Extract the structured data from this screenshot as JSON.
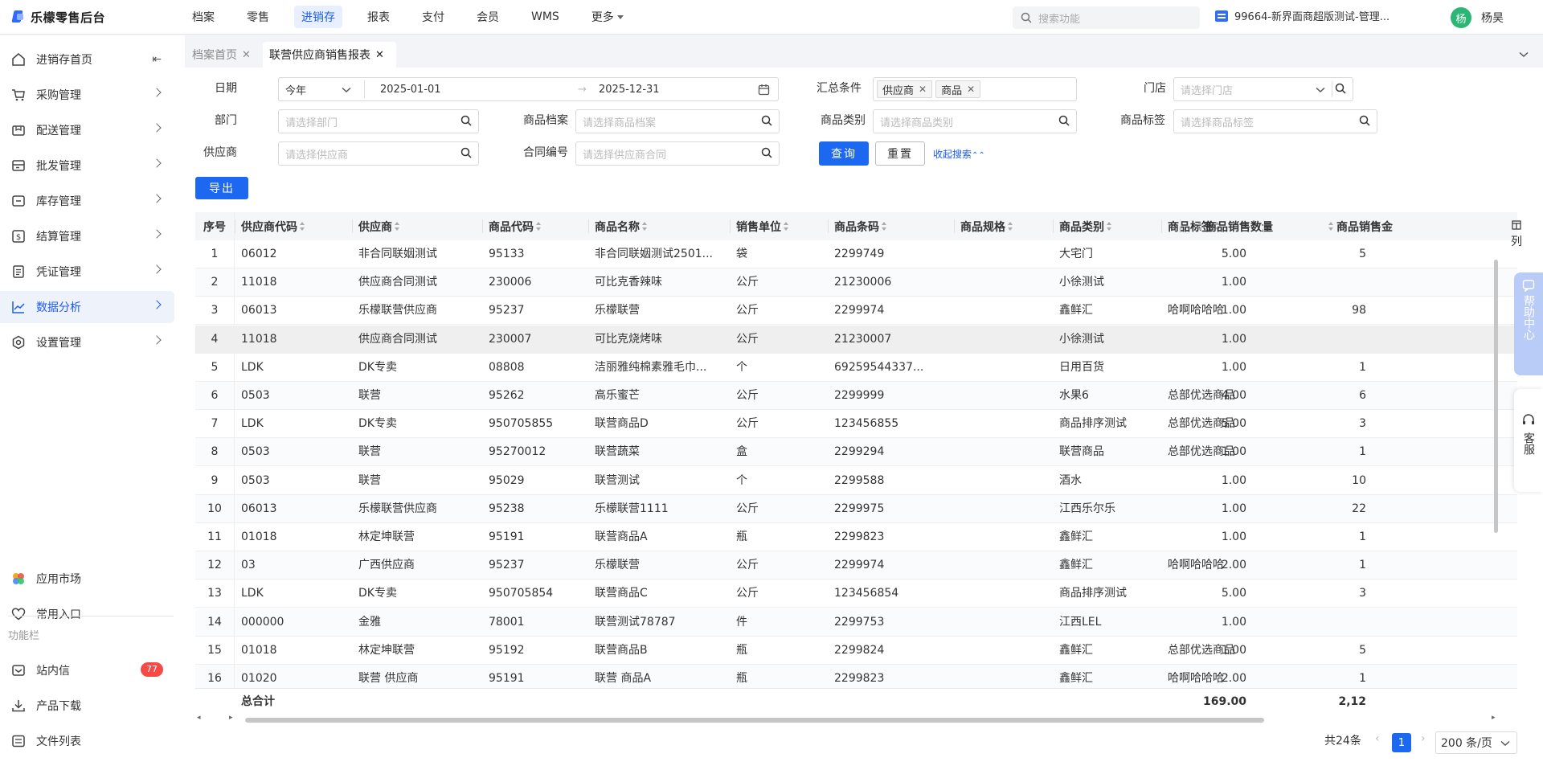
{
  "app": {
    "logo_text": "乐檬零售后台",
    "nav": [
      "档案",
      "零售",
      "进销存",
      "报表",
      "支付",
      "会员",
      "WMS",
      "更多"
    ],
    "active_nav": "进销存",
    "search_placeholder": "搜索功能",
    "store": "99664-新界面商超版测试-管理...",
    "user": {
      "avatar_char": "杨",
      "name": "杨昊"
    }
  },
  "sidebar": {
    "items": [
      {
        "label": "进销存首页",
        "icon": "home-icon"
      },
      {
        "label": "采购管理",
        "icon": "cart-icon"
      },
      {
        "label": "配送管理",
        "icon": "delivery-icon"
      },
      {
        "label": "批发管理",
        "icon": "wholesale-icon"
      },
      {
        "label": "库存管理",
        "icon": "inventory-icon"
      },
      {
        "label": "结算管理",
        "icon": "settlement-icon"
      },
      {
        "label": "凭证管理",
        "icon": "voucher-icon"
      },
      {
        "label": "数据分析",
        "icon": "chart-icon"
      },
      {
        "label": "设置管理",
        "icon": "settings-icon"
      }
    ],
    "active": "数据分析",
    "bottom": [
      {
        "label": "应用市场",
        "icon": "app-market-icon"
      },
      {
        "label": "常用入口",
        "icon": "heart-icon"
      }
    ],
    "caption": "功能栏",
    "func": [
      {
        "label": "站内信",
        "icon": "mail-icon",
        "badge": "77"
      },
      {
        "label": "产品下载",
        "icon": "download-icon"
      },
      {
        "label": "文件列表",
        "icon": "file-list-icon"
      }
    ]
  },
  "tabs": [
    {
      "label": "档案首页",
      "active": false
    },
    {
      "label": "联营供应商销售报表",
      "active": true
    }
  ],
  "filters": {
    "date_label": "日期",
    "date_preset": "今年",
    "date_start": "2025-01-01",
    "date_arrow": "→",
    "date_end": "2025-12-31",
    "summary_label": "汇总条件",
    "summary_tags": [
      "供应商",
      "商品"
    ],
    "store_label": "门店",
    "store_placeholder": "请选择门店",
    "dept_label": "部门",
    "dept_placeholder": "请选择部门",
    "product_label": "商品档案",
    "product_placeholder": "请选择商品档案",
    "category_label": "商品类别",
    "category_placeholder": "请选择商品类别",
    "ptag_label": "商品标签",
    "ptag_placeholder": "请选择商品标签",
    "supplier_label": "供应商",
    "supplier_placeholder": "请选择供应商",
    "contract_label": "合同编号",
    "contract_placeholder": "请选择供应商合同",
    "query_btn": "查询",
    "reset_btn": "重置",
    "collapse_link": "收起搜索"
  },
  "export_btn": "导出",
  "columns_btn": "列",
  "table": {
    "headers": [
      "序号",
      "供应商代码",
      "供应商",
      "商品代码",
      "商品名称",
      "销售单位",
      "商品条码",
      "商品规格",
      "商品类别",
      "商品标签",
      "商品销售数量",
      "商品销售金"
    ],
    "rows": [
      [
        "1",
        "06012",
        "非合同联姻测试",
        "95133",
        "非合同联姻测试2501...",
        "袋",
        "2299749",
        "",
        "大宅门",
        "",
        "5.00",
        "5"
      ],
      [
        "2",
        "11018",
        "供应商合同测试",
        "230006",
        "可比克香辣味",
        "公斤",
        "21230006",
        "",
        "小徐测试",
        "",
        "1.00",
        ""
      ],
      [
        "3",
        "06013",
        "乐檬联营供应商",
        "95237",
        "乐檬联营",
        "公斤",
        "2299974",
        "",
        "鑫鲜汇",
        "哈啊哈哈哈",
        "1.00",
        "98"
      ],
      [
        "4",
        "11018",
        "供应商合同测试",
        "230007",
        "可比克烧烤味",
        "公斤",
        "21230007",
        "",
        "小徐测试",
        "",
        "1.00",
        ""
      ],
      [
        "5",
        "LDK",
        "DK专卖",
        "08808",
        "洁丽雅纯棉素雅毛巾...",
        "个",
        "69259544337...",
        "",
        "日用百货",
        "",
        "1.00",
        "1"
      ],
      [
        "6",
        "0503",
        "联营",
        "95262",
        "高乐蜜芒",
        "公斤",
        "2299999",
        "",
        "水果6",
        "总部优选商品",
        "4.00",
        "6"
      ],
      [
        "7",
        "LDK",
        "DK专卖",
        "950705855",
        "联营商品D",
        "公斤",
        "123456855",
        "",
        "商品排序测试",
        "总部优选商品",
        "5.00",
        "3"
      ],
      [
        "8",
        "0503",
        "联营",
        "95270012",
        "联营蔬菜",
        "盒",
        "2299294",
        "",
        "联营商品",
        "总部优选商品",
        "1.00",
        "1"
      ],
      [
        "9",
        "0503",
        "联营",
        "95029",
        "联营测试",
        "个",
        "2299588",
        "",
        "酒水",
        "",
        "1.00",
        "10"
      ],
      [
        "10",
        "06013",
        "乐檬联营供应商",
        "95238",
        "乐檬联营1111",
        "公斤",
        "2299975",
        "",
        "江西乐尔乐",
        "",
        "1.00",
        "22"
      ],
      [
        "11",
        "01018",
        "林定坤联营",
        "95191",
        "联营商品A",
        "瓶",
        "2299823",
        "",
        "鑫鲜汇",
        "",
        "1.00",
        "1"
      ],
      [
        "12",
        "03",
        "广西供应商",
        "95237",
        "乐檬联营",
        "公斤",
        "2299974",
        "",
        "鑫鲜汇",
        "哈啊哈哈哈",
        "2.00",
        "1"
      ],
      [
        "13",
        "LDK",
        "DK专卖",
        "950705854",
        "联营商品C",
        "公斤",
        "123456854",
        "",
        "商品排序测试",
        "",
        "5.00",
        "3"
      ],
      [
        "14",
        "000000",
        "金雅",
        "78001",
        "联营测试78787",
        "件",
        "2299753",
        "",
        "江西LEL",
        "",
        "1.00",
        ""
      ],
      [
        "15",
        "01018",
        "林定坤联营",
        "95192",
        "联营商品B",
        "瓶",
        "2299824",
        "",
        "鑫鲜汇",
        "总部优选商品",
        "1.00",
        "5"
      ],
      [
        "16",
        "01020",
        "联营 供应商",
        "95191",
        "联营 商品A",
        "瓶",
        "2299823",
        "",
        "鑫鲜汇",
        "哈啊哈哈哈",
        "2.00",
        "1"
      ]
    ],
    "total_label": "总合计",
    "total_qty": "169.00",
    "total_amount": "2,12"
  },
  "pagination": {
    "total": "共24条",
    "current": "1",
    "page_size": "200 条/页"
  },
  "float": {
    "help": "帮助中心",
    "cs": "客服"
  },
  "colors": {
    "accent": "#1d68f0",
    "badge": "#f54a45"
  }
}
